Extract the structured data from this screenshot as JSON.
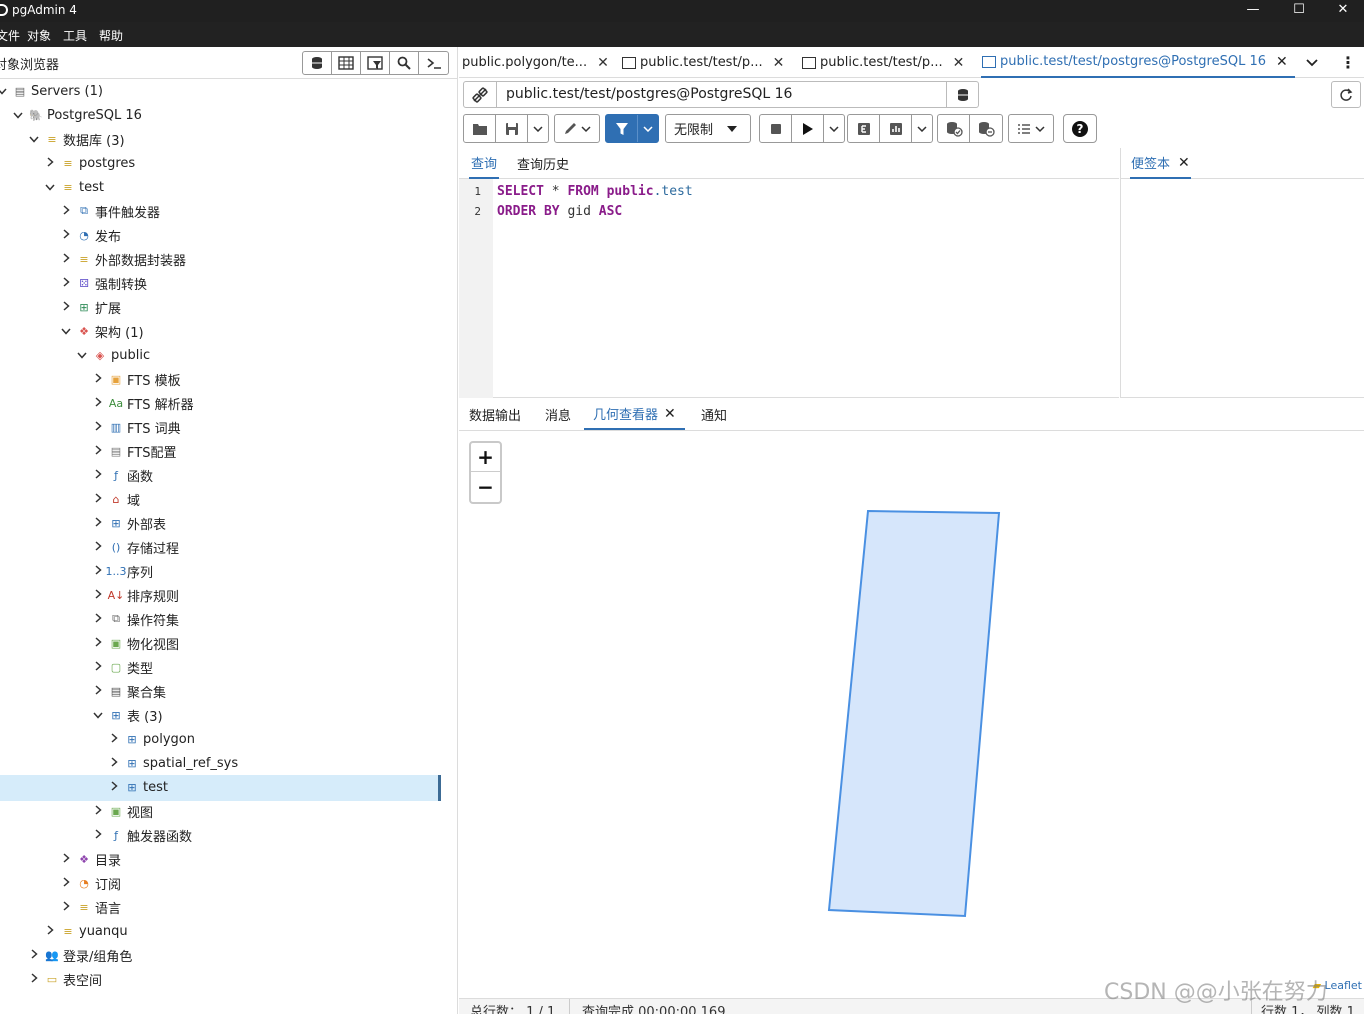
{
  "window": {
    "title": "pgAdmin 4",
    "min": "—",
    "max": "☐",
    "close": "✕"
  },
  "menu": [
    "文件",
    "对象",
    "工具",
    "帮助"
  ],
  "browser": {
    "title": "对象浏览器",
    "tree": [
      {
        "label": "Servers (1)",
        "chev": "v",
        "icon": "▤",
        "color": "#666"
      },
      {
        "label": "PostgreSQL 16",
        "chev": "v",
        "icon": "🐘",
        "color": "#336791"
      },
      {
        "label": "数据库 (3)",
        "chev": "v",
        "icon": "≡",
        "color": "#c9a227"
      },
      {
        "label": "postgres",
        "chev": ">",
        "icon": "≡",
        "color": "#c9a227"
      },
      {
        "label": "test",
        "chev": "v",
        "icon": "≡",
        "color": "#c9a227"
      },
      {
        "label": "事件触发器",
        "chev": ">",
        "icon": "⧉",
        "color": "#2f6fb3"
      },
      {
        "label": "发布",
        "chev": ">",
        "icon": "◔",
        "color": "#2f6fb3"
      },
      {
        "label": "外部数据封装器",
        "chev": ">",
        "icon": "≡",
        "color": "#c9a227"
      },
      {
        "label": "强制转换",
        "chev": ">",
        "icon": "⚄",
        "color": "#6a5acd"
      },
      {
        "label": "扩展",
        "chev": ">",
        "icon": "⊞",
        "color": "#2e8b57"
      },
      {
        "label": "架构 (1)",
        "chev": "v",
        "icon": "❖",
        "color": "#d9534f"
      },
      {
        "label": "public",
        "chev": "v",
        "icon": "◈",
        "color": "#d9534f"
      },
      {
        "label": "FTS 模板",
        "chev": ">",
        "icon": "▣",
        "color": "#e6a23c"
      },
      {
        "label": "FTS 解析器",
        "chev": ">",
        "icon": "Aa",
        "color": "#3c8d3c"
      },
      {
        "label": "FTS 词典",
        "chev": ">",
        "icon": "▥",
        "color": "#2f6fb3"
      },
      {
        "label": "FTS配置",
        "chev": ">",
        "icon": "▤",
        "color": "#777"
      },
      {
        "label": "函数",
        "chev": ">",
        "icon": "ƒ",
        "color": "#2f6fb3"
      },
      {
        "label": "域",
        "chev": ">",
        "icon": "⌂",
        "color": "#c0392b"
      },
      {
        "label": "外部表",
        "chev": ">",
        "icon": "⊞",
        "color": "#2f6fb3"
      },
      {
        "label": "存储过程",
        "chev": ">",
        "icon": "()",
        "color": "#2f6fb3"
      },
      {
        "label": "序列",
        "chev": ">",
        "icon": "1..3",
        "color": "#2f6fb3"
      },
      {
        "label": "排序规则",
        "chev": ">",
        "icon": "A↓",
        "color": "#c0392b"
      },
      {
        "label": "操作符集",
        "chev": ">",
        "icon": "⧉",
        "color": "#666"
      },
      {
        "label": "物化视图",
        "chev": ">",
        "icon": "▣",
        "color": "#6aa84f"
      },
      {
        "label": "类型",
        "chev": ">",
        "icon": "▢",
        "color": "#6aa84f"
      },
      {
        "label": "聚合集",
        "chev": ">",
        "icon": "▤",
        "color": "#555"
      },
      {
        "label": "表 (3)",
        "chev": "v",
        "icon": "⊞",
        "color": "#2f6fb3"
      },
      {
        "label": "polygon",
        "chev": ">",
        "icon": "⊞",
        "color": "#2f6fb3"
      },
      {
        "label": "spatial_ref_sys",
        "chev": ">",
        "icon": "⊞",
        "color": "#2f6fb3"
      },
      {
        "label": "test",
        "chev": ">",
        "icon": "⊞",
        "color": "#2f6fb3"
      },
      {
        "label": "视图",
        "chev": ">",
        "icon": "▣",
        "color": "#6aa84f"
      },
      {
        "label": "触发器函数",
        "chev": ">",
        "icon": "ƒ",
        "color": "#2f6fb3"
      },
      {
        "label": "目录",
        "chev": ">",
        "icon": "❖",
        "color": "#8e44ad"
      },
      {
        "label": "订阅",
        "chev": ">",
        "icon": "◔",
        "color": "#e67e22"
      },
      {
        "label": "语言",
        "chev": ">",
        "icon": "≡",
        "color": "#c9a227"
      },
      {
        "label": "yuanqu",
        "chev": ">",
        "icon": "≡",
        "color": "#c9a227"
      },
      {
        "label": "登录/组角色",
        "chev": ">",
        "icon": "👥",
        "color": "#c0392b"
      },
      {
        "label": "表空间",
        "chev": ">",
        "icon": "▭",
        "color": "#c9a227"
      }
    ]
  },
  "tabs": [
    {
      "label": "public.polygon/te...",
      "close": "✕"
    },
    {
      "label": "public.test/test/p...",
      "close": "✕"
    },
    {
      "label": "public.test/test/p...",
      "close": "✕"
    },
    {
      "label": "public.test/test/postgres@PostgreSQL 16",
      "close": "✕"
    }
  ],
  "connection": {
    "value": "public.test/test/postgres@PostgreSQL 16"
  },
  "toolbar": {
    "limit_label": "无限制"
  },
  "editor_tabs": {
    "query": "查询",
    "history": "查询历史",
    "scratch": "便签本",
    "scratch_close": "✕"
  },
  "code": {
    "line1": {
      "num": "1",
      "kw1": "SELECT",
      "star": " * ",
      "kw2": "FROM",
      "sch": "public",
      "dot": ".",
      "tbl": "test"
    },
    "line2": {
      "num": "2",
      "kw1": "ORDER BY",
      "col": " gid ",
      "kw2": "ASC"
    }
  },
  "result_tabs": {
    "data": "数据输出",
    "messages": "消息",
    "geometry": "几何查看器",
    "geometry_close": "✕",
    "notify": "通知"
  },
  "map": {
    "zoom_in": "+",
    "zoom_out": "−",
    "attribution": "Leaflet",
    "fill": "#d6e6fb",
    "stroke": "#4a90e2"
  },
  "status": {
    "total_rows": "总行数： 1 / 1",
    "query_done": "查询完成 00:00:00.169",
    "rows_cols": "行数 1， 列数 1"
  },
  "watermark": "CSDN @@小张在努力"
}
